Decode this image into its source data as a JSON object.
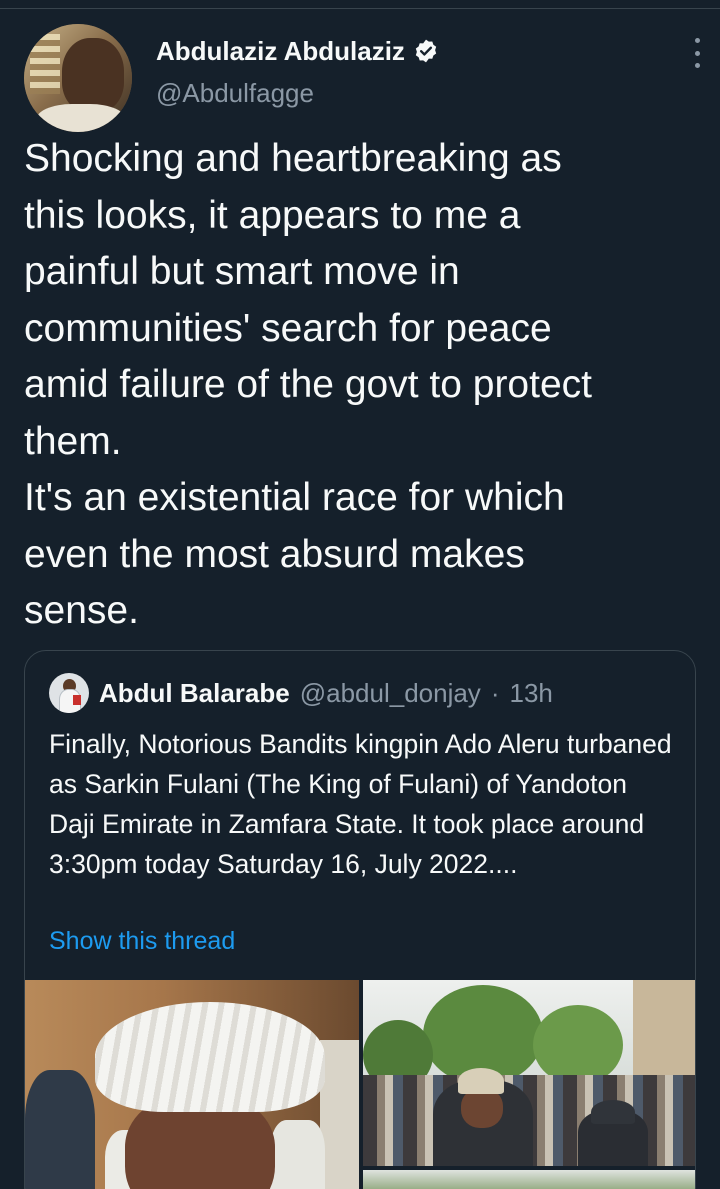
{
  "tweet": {
    "author": {
      "display_name": "Abdulaziz Abdulaziz",
      "handle": "@Abdulfagge",
      "verified": true,
      "avatar_icon": "user-avatar"
    },
    "text": "Shocking and heartbreaking as\nthis looks, it appears to me a\npainful but smart move in\ncommunities' search for peace\namid failure of the govt to protect\nthem.\nIt's an existential race for which\neven the most absurd makes\nsense.",
    "more_icon": "more-vertical-icon"
  },
  "quoted_tweet": {
    "author": {
      "display_name": "Abdul Balarabe",
      "handle": "@abdul_donjay",
      "separator": "·",
      "time": "13h"
    },
    "text": "Finally, Notorious Bandits kingpin Ado Aleru turbaned as Sarkin Fulani (The King of Fulani) of Yandoton Daji Emirate in Zamfara State. It took place around 3:30pm today Saturday 16, July 2022....",
    "show_thread_label": "Show this thread",
    "media_count": 3
  },
  "colors": {
    "background": "#15202b",
    "text_primary": "#f7f9f9",
    "text_secondary": "#8b98a5",
    "link": "#1d9bf0",
    "border": "#38444d"
  }
}
